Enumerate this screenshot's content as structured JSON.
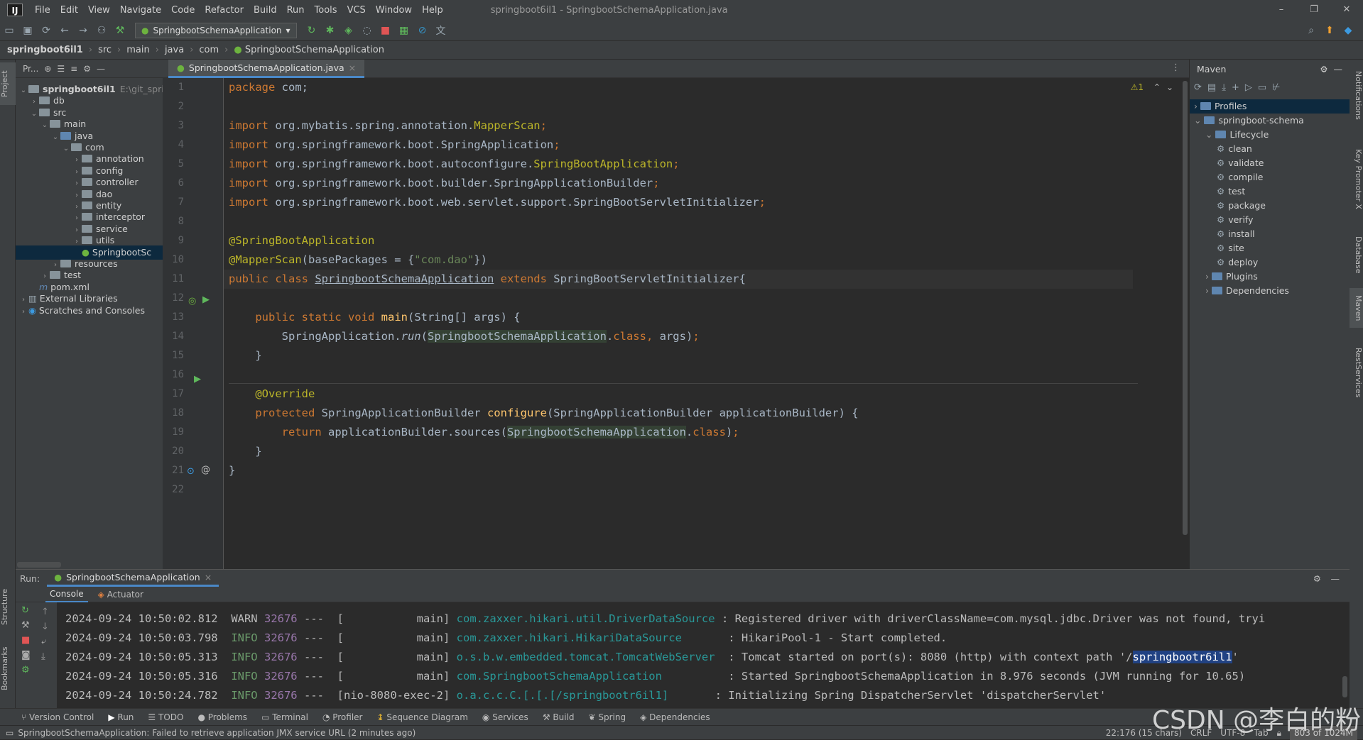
{
  "menubar": {
    "logo": "IJ",
    "items": [
      "File",
      "Edit",
      "View",
      "Navigate",
      "Code",
      "Refactor",
      "Build",
      "Run",
      "Tools",
      "VCS",
      "Window",
      "Help"
    ],
    "window_title": "springboot6il1 - SpringbootSchemaApplication.java",
    "controls": [
      "–",
      "❐",
      "✕"
    ]
  },
  "toolbar": {
    "run_config": "SpringbootSchemaApplication"
  },
  "breadcrumb": [
    "springboot6il1",
    "src",
    "main",
    "java",
    "com",
    "SpringbootSchemaApplication"
  ],
  "left_strip": {
    "project": "Project",
    "structure": "Structure",
    "bookmarks": "Bookmarks"
  },
  "project_panel": {
    "header": "Pr...",
    "tree": [
      {
        "label": "springboot6il1",
        "extra": "E:\\git_sprin",
        "arrow": "⌄",
        "icon": "module",
        "bold": true
      },
      {
        "label": "db",
        "arrow": "›",
        "icon": "folder"
      },
      {
        "label": "src",
        "arrow": "⌄",
        "icon": "folder"
      },
      {
        "label": "main",
        "arrow": "⌄",
        "icon": "folder"
      },
      {
        "label": "java",
        "arrow": "⌄",
        "icon": "folder-blue"
      },
      {
        "label": "com",
        "arrow": "⌄",
        "icon": "folder"
      },
      {
        "label": "annotation",
        "arrow": "›",
        "icon": "folder"
      },
      {
        "label": "config",
        "arrow": "›",
        "icon": "folder"
      },
      {
        "label": "controller",
        "arrow": "›",
        "icon": "folder"
      },
      {
        "label": "dao",
        "arrow": "›",
        "icon": "folder"
      },
      {
        "label": "entity",
        "arrow": "›",
        "icon": "folder"
      },
      {
        "label": "interceptor",
        "arrow": "›",
        "icon": "folder"
      },
      {
        "label": "service",
        "arrow": "›",
        "icon": "folder"
      },
      {
        "label": "utils",
        "arrow": "›",
        "icon": "folder"
      },
      {
        "label": "SpringbootSc",
        "arrow": "",
        "icon": "spring-class",
        "selected": true
      },
      {
        "label": "resources",
        "arrow": "›",
        "icon": "folder"
      },
      {
        "label": "test",
        "arrow": "›",
        "icon": "folder"
      },
      {
        "label": "pom.xml",
        "arrow": "",
        "icon": "maven-file"
      },
      {
        "label": "External Libraries",
        "arrow": "›",
        "icon": "library"
      },
      {
        "label": "Scratches and Consoles",
        "arrow": "›",
        "icon": "scratches"
      }
    ]
  },
  "editor": {
    "tab_label": "SpringbootSchemaApplication.java",
    "inspection": "⚠1",
    "line_numbers": [
      "1",
      "2",
      "3",
      "4",
      "5",
      "6",
      "7",
      "8",
      "9",
      "10",
      "11",
      "12",
      "13",
      "14",
      "15",
      "16",
      "17",
      "18",
      "19",
      "20",
      "21",
      "22"
    ]
  },
  "maven": {
    "title": "Maven",
    "tree": [
      {
        "label": "Profiles",
        "arrow": "›",
        "selected": true,
        "indent": 0
      },
      {
        "label": "springboot-schema",
        "arrow": "⌄",
        "indent": 0
      },
      {
        "label": "Lifecycle",
        "arrow": "⌄",
        "indent": 1
      },
      {
        "label": "clean",
        "indent": 2,
        "gear": true
      },
      {
        "label": "validate",
        "indent": 2,
        "gear": true
      },
      {
        "label": "compile",
        "indent": 2,
        "gear": true
      },
      {
        "label": "test",
        "indent": 2,
        "gear": true
      },
      {
        "label": "package",
        "indent": 2,
        "gear": true
      },
      {
        "label": "verify",
        "indent": 2,
        "gear": true
      },
      {
        "label": "install",
        "indent": 2,
        "gear": true
      },
      {
        "label": "site",
        "indent": 2,
        "gear": true
      },
      {
        "label": "deploy",
        "indent": 2,
        "gear": true
      },
      {
        "label": "Plugins",
        "arrow": "›",
        "indent": 1
      },
      {
        "label": "Dependencies",
        "arrow": "›",
        "indent": 1
      }
    ]
  },
  "right_strip": {
    "notifications": "Notifications",
    "key_promoter": "Key Promoter X",
    "database": "Database",
    "maven": "Maven",
    "rest": "RestServices"
  },
  "run_panel": {
    "label": "Run:",
    "tab": "SpringbootSchemaApplication",
    "subtabs": [
      "Console",
      "Actuator"
    ],
    "log": [
      {
        "ts": "2024-09-24 10:50:02.812",
        "level": "WARN",
        "pid": "32676",
        "thread": "---  [           main]",
        "cls": "com.zaxxer.hikari.util.DriverDataSource",
        "msg": " : Registered driver with driverClassName=com.mysql.jdbc.Driver was not found, tryi"
      },
      {
        "ts": "2024-09-24 10:50:03.798",
        "level": "INFO",
        "pid": "32676",
        "thread": "---  [           main]",
        "cls": "com.zaxxer.hikari.HikariDataSource      ",
        "msg": " : HikariPool-1 - Start completed."
      },
      {
        "ts": "2024-09-24 10:50:05.313",
        "level": "INFO",
        "pid": "32676",
        "thread": "---  [           main]",
        "cls": "o.s.b.w.embedded.tomcat.TomcatWebServer ",
        "msg": " : Tomcat started on port(s): 8080 (http) with context path '/",
        "sel": "springbootr6il1",
        "tail": "'"
      },
      {
        "ts": "2024-09-24 10:50:05.316",
        "level": "INFO",
        "pid": "32676",
        "thread": "---  [           main]",
        "cls": "com.SpringbootSchemaApplication         ",
        "msg": " : Started SpringbootSchemaApplication in 8.976 seconds (JVM running for 10.65)"
      },
      {
        "ts": "2024-09-24 10:50:24.782",
        "level": "INFO",
        "pid": "32676",
        "thread": "---  [nio-8080-exec-2]",
        "cls": "o.a.c.c.C.[.[.[/springbootr6il1]      ",
        "msg": " : Initializing Spring DispatcherServlet 'dispatcherServlet'"
      }
    ]
  },
  "bottom_tabs": [
    "Version Control",
    "Run",
    "TODO",
    "Problems",
    "Terminal",
    "Profiler",
    "Sequence Diagram",
    "Services",
    "Build",
    "Spring",
    "Dependencies"
  ],
  "status": {
    "message": "SpringbootSchemaApplication: Failed to retrieve application JMX service URL (2 minutes ago)",
    "position": "22:176 (15 chars)",
    "line_sep": "CRLF",
    "encoding": "UTF-8",
    "indent": "Tab",
    "memory": "803 of 1024M"
  },
  "watermark": "CSDN @李白的粉"
}
